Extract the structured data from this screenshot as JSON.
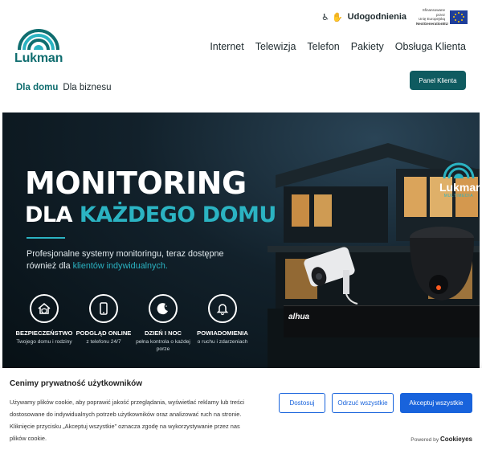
{
  "topbar": {
    "accessibility_label": "Udogodnienia",
    "eu_text": [
      "Sfinansowane przez",
      "Unię Europejską",
      "NextGenerationEU"
    ]
  },
  "logo": {
    "name": "Lukman"
  },
  "nav": {
    "items": [
      "Internet",
      "Telewizja",
      "Telefon",
      "Pakiety",
      "Obsługa Klienta"
    ]
  },
  "segments": {
    "active": "Dla domu",
    "other": "Dla biznesu"
  },
  "panel_button": "Panel Klienta",
  "hero": {
    "title_line1": "MONITORING",
    "title_line2_prefix": "DLA ",
    "title_line2_accent": "KAŻDEGO DOMU",
    "subtitle_pre": "Profesjonalne systemy monitoringu, teraz dostępne również dla ",
    "subtitle_accent": "klientów indywidualnych.",
    "brand_name": "Lukman",
    "brand_sub": "MULTIMEDIA",
    "nvr_brand": "alhua",
    "features": [
      {
        "icon": "house-shield-icon",
        "title": "BEZPIECZEŃSTWO",
        "desc": "Twojego domu i rodziny"
      },
      {
        "icon": "smartphone-icon",
        "title": "PODGLĄD ONLINE",
        "desc": "z telefonu 24/7"
      },
      {
        "icon": "moon-icon",
        "title": "DZIEŃ I NOC",
        "desc": "pełna kontrola o każdej porze"
      },
      {
        "icon": "bell-icon",
        "title": "POWIADOMIENIA",
        "desc": "o ruchu i zdarzeniach"
      }
    ]
  },
  "cookie": {
    "title": "Cenimy prywatność użytkowników",
    "text": "Używamy plików cookie, aby poprawić jakość przeglądania, wyświetlać reklamy lub treści dostosowane do indywidualnych potrzeb użytkowników oraz analizować ruch na stronie. Kliknięcie przycisku „Akceptuj wszystkie” oznacza zgodę na wykorzystywanie przez nas plików cookie.",
    "customize": "Dostosuj",
    "reject": "Odrzuć wszystkie",
    "accept": "Akceptuj wszystkie",
    "powered_prefix": "Powered by",
    "powered_brand": "Cookieyes"
  },
  "colors": {
    "brand": "#0f6d6f",
    "accent": "#2bb3c2",
    "cookie_blue": "#1863dc"
  }
}
